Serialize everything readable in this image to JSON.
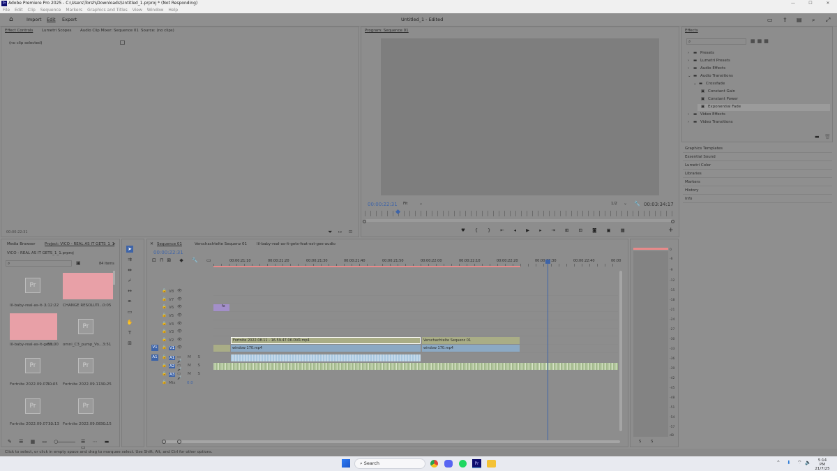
{
  "window": {
    "title": "Adobe Premiere Pro 2025 - C:\\Users\\Torsh\\Downloads\\Untitled_1.prproj * (Not Responding)",
    "app_icon": "Pr"
  },
  "menu": [
    "File",
    "Edit",
    "Clip",
    "Sequence",
    "Markers",
    "Graphics and Titles",
    "View",
    "Window",
    "Help"
  ],
  "nav": {
    "import": "Import",
    "edit": "Edit",
    "export": "Export",
    "doc_title": "Untitled_1 - Edited"
  },
  "source_tabs": [
    "Effect Controls",
    "Lumetri Scopes",
    "Audio Clip Mixer: Sequence 01",
    "Source: (no clips)"
  ],
  "effect_controls": {
    "no_clip": "(no clip selected)",
    "time": "00:00:22:31"
  },
  "program": {
    "tab": "Program: Sequence 01",
    "timecode": "00:00:22:31",
    "fit": "Fit",
    "quality": "1/2",
    "duration": "00:03:34:17"
  },
  "effects": {
    "tab": "Effects",
    "tree": [
      "Presets",
      "Lumetri Presets",
      "Audio Effects",
      "Audio Transitions",
      "Crossfade",
      "Constant Gain",
      "Constant Power",
      "Exponential Fade",
      "Video Effects",
      "Video Transitions"
    ],
    "links": [
      "Graphics Templates",
      "Essential Sound",
      "Lumetri Color",
      "Libraries",
      "Markers",
      "History",
      "Info"
    ]
  },
  "project": {
    "tabs": [
      "Media Browser",
      "Project: VICO - REAL AS IT GETS_1_1"
    ],
    "file": "VICO - REAL AS IT GETS_1_1.prproj",
    "count": "84 items",
    "items": [
      {
        "name": "lil-baby-real-as-it-...",
        "dur": "3:12:22"
      },
      {
        "name": "CHANGE RESOLUTI...",
        "dur": "0:05"
      },
      {
        "name": "lil-baby-real-as-it-gets...",
        "dur": "53:00"
      },
      {
        "name": "omni_C3_pump_Vo...",
        "dur": "3:51"
      },
      {
        "name": "Fortnite 2022.09.07 -...",
        "dur": "30:05"
      },
      {
        "name": "Fortnite 2022.09.11 -...",
        "dur": "30:25"
      },
      {
        "name": "Fortnite 2022.09.07 -...",
        "dur": "30:13"
      },
      {
        "name": "Fortnite 2022.09.08 -...",
        "dur": "30:15"
      }
    ]
  },
  "timeline": {
    "tabs": [
      "Sequence 01",
      "Verschachtelte Sequenz 01",
      "lil-baby-real-as-it-gets-feat-est-gee-audio"
    ],
    "timecode": "00:00:22:31",
    "ruler": [
      "00:00:21:10",
      "00:00:21:20",
      "00:00:21:30",
      "00:00:21:40",
      "00:00:21:50",
      "00:00:22:00",
      "00:00:22:10",
      "00:00:22:20",
      "00:00:22:30",
      "00:00:22:40",
      "00:00"
    ],
    "tracks": [
      "V8",
      "V7",
      "V6",
      "V5",
      "V4",
      "V3",
      "V2",
      "V1",
      "A1",
      "A2",
      "A3",
      "Mix"
    ],
    "mix_value": "0.0",
    "clips": {
      "v2a": "Fortnite 2022.08.11 - 16.59.47.06.DVR.mp4",
      "v2b": "Verschachtelte Sequenz 01",
      "v1a": "window 170.mp4",
      "v1b": "window 170.mp4"
    }
  },
  "meter_scale": [
    "0",
    "-3",
    "-6",
    "-9",
    "-12",
    "-15",
    "-18",
    "-21",
    "-24",
    "-27",
    "-30",
    "-33",
    "-36",
    "-39",
    "-42",
    "-45",
    "-48",
    "-51",
    "-54",
    "-57",
    "dB"
  ],
  "status": "Click to select, or click in empty space and drag to marquee select. Use Shift, Alt, and Ctrl for other options.",
  "taskbar": {
    "search": "Search",
    "time": "5:14 PM",
    "date": "21/7/25"
  },
  "colors": {
    "accent": "#3e64a8",
    "video_clip": "#8ba9c4",
    "audio_clip": "#b7c9a4",
    "nested": "#a9ad86",
    "purple": "#a38fc9",
    "pink": "#e8a0a7"
  }
}
